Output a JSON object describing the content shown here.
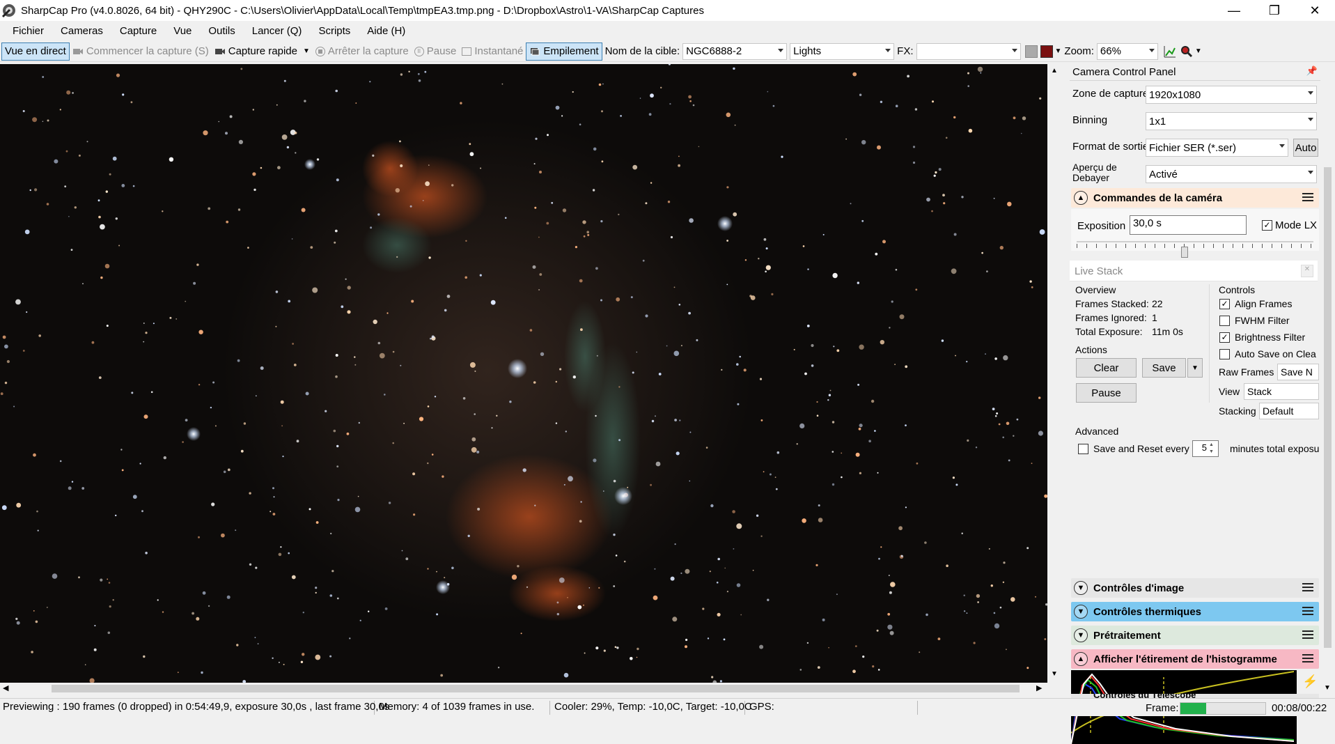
{
  "window": {
    "title": "SharpCap Pro (v4.0.8026, 64 bit) - QHY290C - C:\\Users\\Olivier\\AppData\\Local\\Temp\\tmpEA3.tmp.png - D:\\Dropbox\\Astro\\1-VA\\SharpCap Captures",
    "minimize": "—",
    "restore": "❐",
    "close": "✕"
  },
  "menu": [
    "Fichier",
    "Cameras",
    "Capture",
    "Vue",
    "Outils",
    "Lancer (Q)",
    "Scripts",
    "Aide (H)"
  ],
  "toolbar": {
    "live_view": "Vue en direct",
    "start_capture": "Commencer la capture (S)",
    "quick_capture": "Capture rapide",
    "stop_capture": "Arrêter la capture",
    "pause": "Pause",
    "snapshot": "Instantané",
    "stacking": "Empilement",
    "target_label": "Nom de la cible:",
    "target_value": "NGC6888-2",
    "frame_type": "Lights",
    "fx_label": "FX:",
    "fx_value": "",
    "zoom_label": "Zoom:",
    "zoom_value": "66%"
  },
  "panel": {
    "title": "Camera Control Panel",
    "capture_area_label": "Zone de capture",
    "capture_area_value": "1920x1080",
    "binning_label": "Binning",
    "binning_value": "1x1",
    "output_format_label": "Format de sortie",
    "output_format_value": "Fichier SER (*.ser)",
    "auto_label": "Auto",
    "debayer_label_1": "Aperçu de",
    "debayer_label_2": "Debayer",
    "debayer_value": "Activé",
    "camera_controls": "Commandes de la caméra",
    "exposure_label": "Exposition",
    "exposure_value": "30,0 s",
    "lx_mode": "Mode LX",
    "image_controls": "Contrôles d'image",
    "thermal_controls": "Contrôles thermiques",
    "preprocessing": "Prétraitement",
    "histogram": "Afficher l'étirement de l'histogramme",
    "telescope": "Contrôles du Télescope"
  },
  "livestack": {
    "title": "Live Stack",
    "overview": "Overview",
    "frames_stacked_label": "Frames Stacked:",
    "frames_stacked": "22",
    "frames_ignored_label": "Frames Ignored:",
    "frames_ignored": "1",
    "total_exposure_label": "Total Exposure:",
    "total_exposure": "11m 0s",
    "actions": "Actions",
    "clear": "Clear",
    "save": "Save",
    "pause": "Pause",
    "controls": "Controls",
    "align_frames": "Align Frames",
    "fwhm_filter": "FWHM Filter",
    "brightness_filter": "Brightness Filter",
    "auto_save": "Auto Save on Clea",
    "raw_frames_label": "Raw Frames",
    "raw_frames_value": "Save N",
    "view_label": "View",
    "view_value": "Stack",
    "stacking_label": "Stacking",
    "stacking_value": "Default",
    "advanced": "Advanced",
    "save_reset": "Save and Reset every",
    "save_reset_value": "5",
    "minutes_total": "minutes total exposu"
  },
  "status": {
    "previewing": "Previewing : 190 frames (0 dropped) in 0:54:49,9, exposure 30,0s , last frame 30,0s",
    "memory": "Memory: 4 of 1039 frames in use.",
    "cooler": "Cooler: 29%, Temp: -10,0C, Target: -10,0C",
    "gps": "GPS:",
    "frame_label": "Frame:",
    "frame_progress": 0.3,
    "time": "00:08/00:22"
  },
  "colors": {
    "accent": "#cce4f7",
    "camera_section": "#fde9d9",
    "thermal_section": "#7dc8f0",
    "preprocessing_section": "#dde9dd",
    "histogram_section": "#f7b8c4",
    "frame_bar": "#22b14c"
  }
}
